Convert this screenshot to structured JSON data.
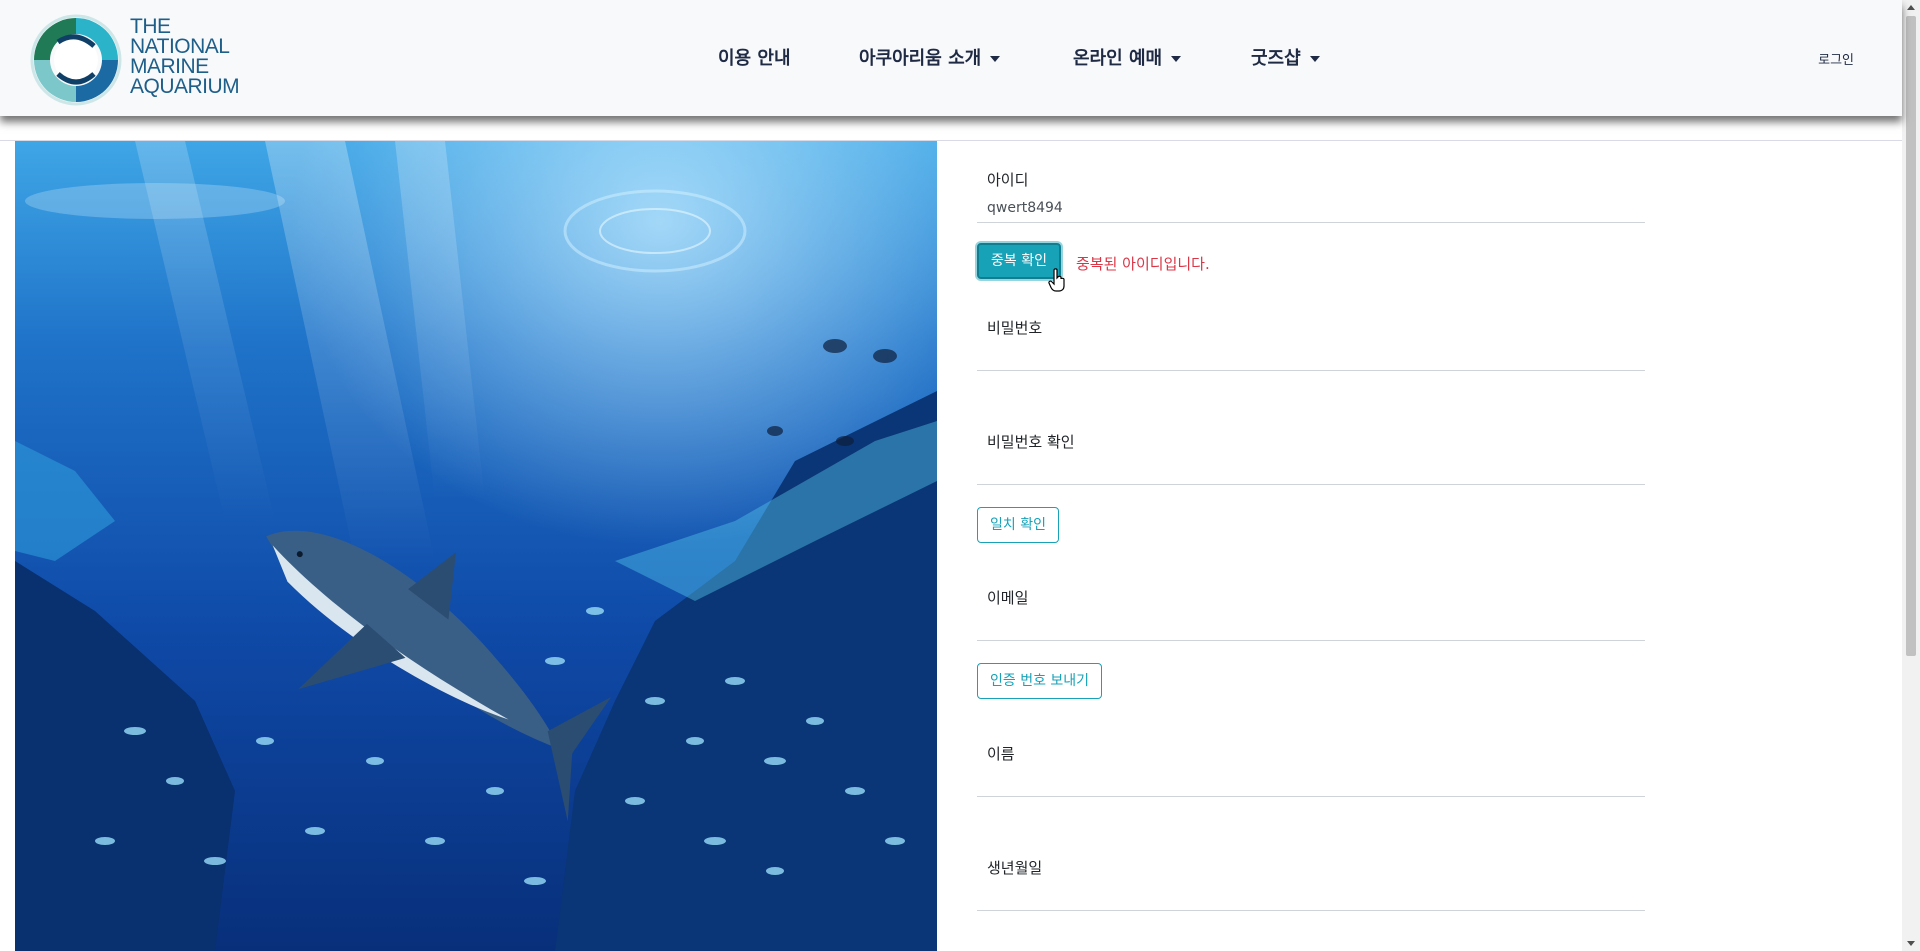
{
  "header": {
    "logo_lines": [
      "THE",
      "NATIONAL",
      "MARINE",
      "AQUARIUM"
    ],
    "nav": [
      {
        "label": "이용 안내",
        "dropdown": false
      },
      {
        "label": "아쿠아리움 소개",
        "dropdown": true
      },
      {
        "label": "온라인 예매",
        "dropdown": true
      },
      {
        "label": "굿즈샵",
        "dropdown": true
      }
    ],
    "login_label": "로그인"
  },
  "hero": {
    "icon": "shark-underwater-image"
  },
  "form": {
    "id_label": "아이디",
    "id_value": "qwert8494",
    "duplicate_check_label": "중복 확인",
    "duplicate_message": "중복된 아이디입니다.",
    "password_label": "비밀번호",
    "password_value": "",
    "password_confirm_label": "비밀번호 확인",
    "password_confirm_value": "",
    "match_check_label": "일치 확인",
    "email_label": "이메일",
    "email_value": "",
    "send_code_label": "인증 번호 보내기",
    "name_label": "이름",
    "name_value": "",
    "birthdate_label": "생년월일",
    "birthdate_value": ""
  },
  "colors": {
    "accent": "#17a2b8",
    "error": "#dc3545",
    "nav_text": "#1f2a44",
    "header_bg": "#f8f9fb"
  }
}
